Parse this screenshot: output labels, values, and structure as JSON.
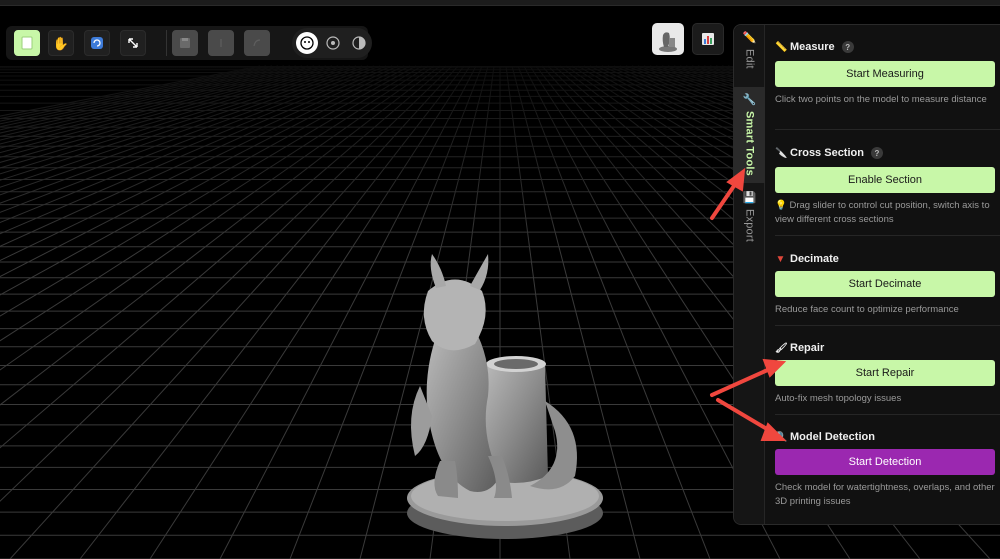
{
  "toolbar": {
    "tools": [
      {
        "name": "select",
        "icon": "select-icon"
      },
      {
        "name": "pan",
        "icon": "hand-icon"
      },
      {
        "name": "rotate",
        "icon": "rotate-icon"
      },
      {
        "name": "scale",
        "icon": "resize-icon"
      },
      {
        "name": "save",
        "icon": "save-icon"
      },
      {
        "name": "undo",
        "icon": "undo-icon"
      },
      {
        "name": "redo",
        "icon": "redo-icon"
      }
    ],
    "view_modes": [
      "solid-view-icon",
      "wireframe-view-icon",
      "half-view-icon"
    ]
  },
  "side_tabs": [
    {
      "label": "Edit",
      "icon": "pencil-icon"
    },
    {
      "label": "Smart Tools",
      "icon": "wrench-icon"
    },
    {
      "label": "Export",
      "icon": "floppy-icon"
    }
  ],
  "sections": {
    "measure": {
      "title": "Measure",
      "help": "?",
      "button": "Start Measuring",
      "desc": "Click two points on the model to measure distance"
    },
    "cross_section": {
      "title": "Cross Section",
      "help": "?",
      "button": "Enable Section",
      "desc": "Drag slider to control cut position, switch axis to view different cross sections"
    },
    "decimate": {
      "title": "Decimate",
      "button": "Start Decimate",
      "desc": "Reduce face count to optimize performance"
    },
    "repair": {
      "title": "Repair",
      "button": "Start Repair",
      "desc": "Auto-fix mesh topology issues"
    },
    "detection": {
      "title": "Model Detection",
      "button": "Start Detection",
      "desc": "Check model for watertightness, overlaps, and other 3D printing issues"
    }
  },
  "colors": {
    "accent_green": "#c8f7a8",
    "accent_purple": "#9b28b0",
    "annotation_red": "#f0473e"
  }
}
